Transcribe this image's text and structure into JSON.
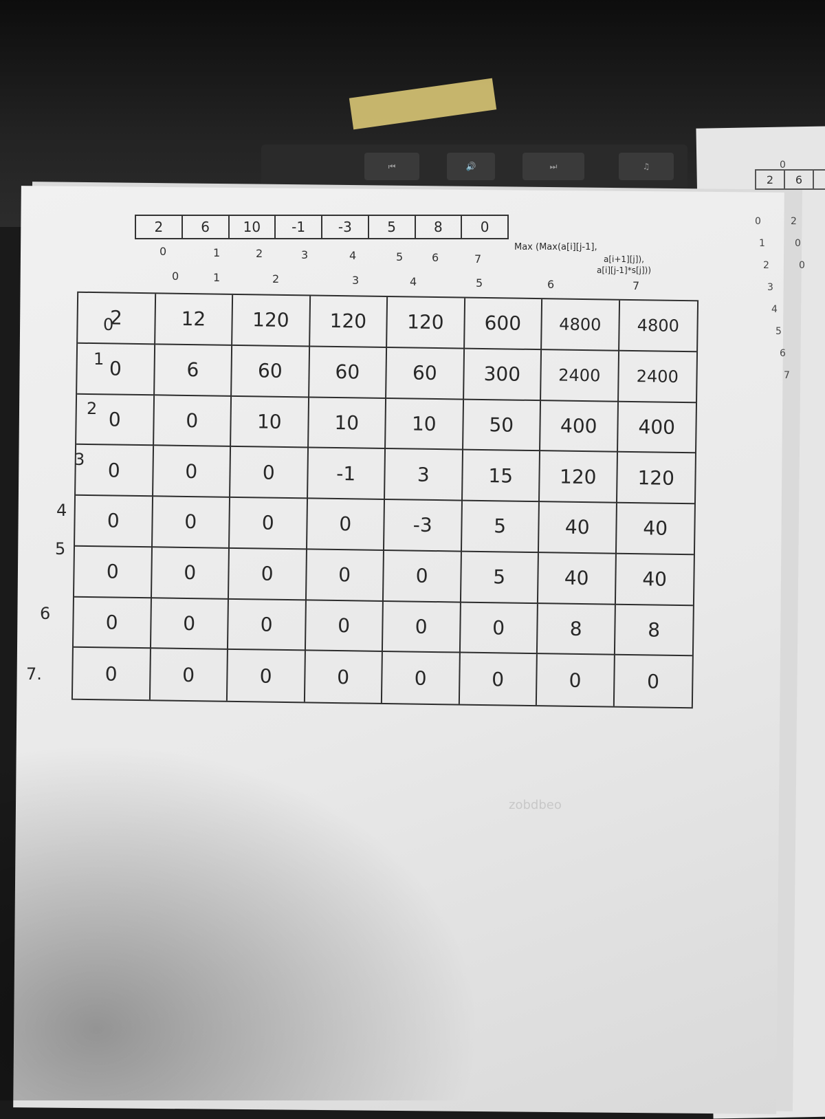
{
  "keyboard": {
    "keys": [
      "⏮",
      "🔊",
      "⏭",
      "♫"
    ]
  },
  "array_row": {
    "values": [
      "2",
      "6",
      "10",
      "-1",
      "-3",
      "5",
      "8",
      "0"
    ],
    "indices": [
      "0",
      "1",
      "2",
      "3",
      "4",
      "5",
      "6",
      "7"
    ]
  },
  "formula": {
    "line1": "Max (Max(a[i][j-1],",
    "line2": "a[i+1][j]),",
    "line3": "a[i][j-1]*s[j]))"
  },
  "table": {
    "column_labels": [
      "0",
      "1",
      "2",
      "3",
      "4",
      "5",
      "6",
      "7"
    ],
    "row_labels": [
      "0",
      "1",
      "2",
      "3",
      "4",
      "5",
      "6",
      "7."
    ],
    "rows": [
      [
        "2",
        "12",
        "120",
        "120",
        "120",
        "600",
        "4800",
        "4800"
      ],
      [
        "0",
        "6",
        "60",
        "60",
        "60",
        "300",
        "2400",
        "2400"
      ],
      [
        "0",
        "0",
        "10",
        "10",
        "10",
        "50",
        "400",
        "400"
      ],
      [
        "0",
        "0",
        "0",
        "-1",
        "3",
        "15",
        "120",
        "120"
      ],
      [
        "0",
        "0",
        "0",
        "0",
        "-3",
        "5",
        "40",
        "40"
      ],
      [
        "0",
        "0",
        "0",
        "0",
        "0",
        "5",
        "40",
        "40"
      ],
      [
        "0",
        "0",
        "0",
        "0",
        "0",
        "0",
        "8",
        "8"
      ],
      [
        "0",
        "0",
        "0",
        "0",
        "0",
        "0",
        "0",
        "0"
      ]
    ]
  },
  "right_sheet": {
    "box_values": [
      "2",
      "6"
    ],
    "top_index": "0",
    "index_col": [
      "0",
      "1",
      "2",
      "3",
      "4",
      "5",
      "6",
      "7"
    ],
    "value_col": [
      "2",
      "0",
      "0"
    ]
  },
  "faint_text": {
    "bleed_label": "zobdbeo"
  },
  "colors": {
    "ink": "#2a2a2a",
    "paper": "#eeeeee",
    "desk": "#1a1a1a",
    "sticky": "#e4d07a"
  }
}
